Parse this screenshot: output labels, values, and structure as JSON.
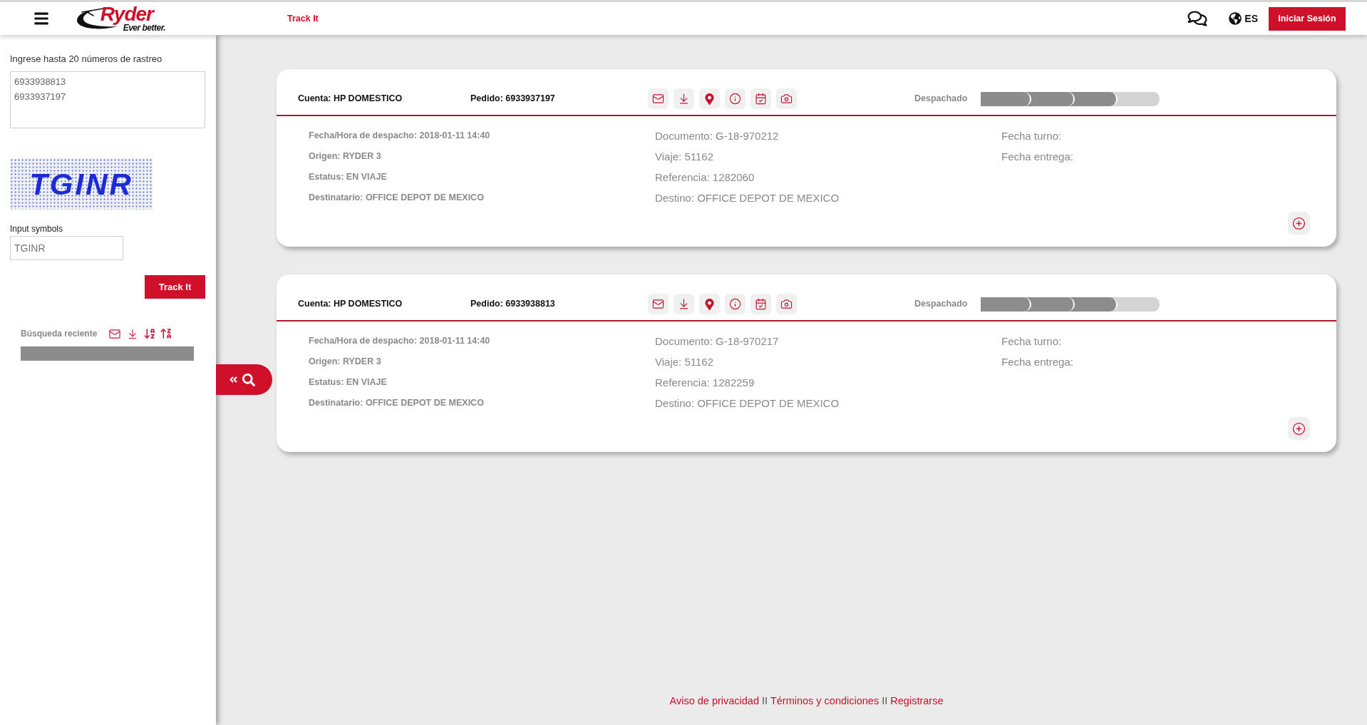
{
  "header": {
    "logo": {
      "wordmark": "Ryder",
      "tagline": "Ever better."
    },
    "nav_link": "Track It",
    "language": "ES",
    "login_button": "Iniciar Sesión"
  },
  "sidebar": {
    "tracking_label": "Ingrese hasta 20 números de rastreo",
    "tracking_numbers": [
      "6933938813",
      "6933937197"
    ],
    "captcha": "TGINR",
    "symbols_label": "Input symbols",
    "symbols_value": "TGINR",
    "submit_button": "Track It",
    "recent_label": "Búsqueda reciente"
  },
  "shipments": [
    {
      "account": "Cuenta: HP DOMESTICO",
      "order": "Pedido: 6933937197",
      "status": "Despachado",
      "progress_steps": [
        {
          "done": true
        },
        {
          "done": true
        },
        {
          "done": true
        },
        {
          "done": false
        }
      ],
      "detail_columns": [
        [
          "Fecha/Hora de despacho: 2018-01-11 14:40",
          "Origen: RYDER 3",
          "Estatus: EN VIAJE",
          "Destinatario: OFFICE DEPOT DE MEXICO"
        ],
        [
          "Documento: G-18-970212",
          "Viaje: 51162",
          "Referencia: 1282060",
          "Destino: OFFICE DEPOT DE MEXICO"
        ],
        [
          "Fecha turno:",
          "Fecha entrega:"
        ]
      ]
    },
    {
      "account": "Cuenta: HP DOMESTICO",
      "order": "Pedido: 6933938813",
      "status": "Despachado",
      "progress_steps": [
        {
          "done": true
        },
        {
          "done": true
        },
        {
          "done": true
        },
        {
          "done": false
        }
      ],
      "detail_columns": [
        [
          "Fecha/Hora de despacho: 2018-01-11 14:40",
          "Origen: RYDER 3",
          "Estatus: EN VIAJE",
          "Destinatario: OFFICE DEPOT DE MEXICO"
        ],
        [
          "Documento: G-18-970217",
          "Viaje: 51162",
          "Referencia: 1282259",
          "Destino: OFFICE DEPOT DE MEXICO"
        ],
        [
          "Fecha turno:",
          "Fecha entrega:"
        ]
      ]
    }
  ],
  "footer": [
    {
      "kind": "link",
      "text": "Aviso de privacidad"
    },
    {
      "kind": "separator",
      "text": "II"
    },
    {
      "kind": "link",
      "text": "Términos y condiciones"
    },
    {
      "kind": "separator",
      "text": "II"
    },
    {
      "kind": "link",
      "text": "Registrarse"
    }
  ]
}
